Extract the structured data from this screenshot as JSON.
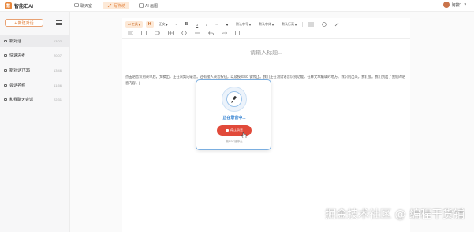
{
  "app": {
    "logo_text": "智能汇AI",
    "logo_badge": "慧"
  },
  "nav": {
    "tabs": [
      {
        "label": "聊天室",
        "active": false
      },
      {
        "label": "写作坊",
        "active": true
      },
      {
        "label": "AI 画图",
        "active": false
      }
    ]
  },
  "user": {
    "name": "阿搜1"
  },
  "sidebar": {
    "new_chat_label": "+ 新建对话",
    "conversations": [
      {
        "title": "新对话",
        "time": "13:02",
        "active": true
      },
      {
        "title": "快速思考",
        "time": "20:07",
        "active": false
      },
      {
        "title": "新对话7736",
        "time": "13:46",
        "active": false
      },
      {
        "title": "会话名称",
        "time": "11:56",
        "active": false
      },
      {
        "title": "和我聊天会话",
        "time": "22:31",
        "active": false
      }
    ]
  },
  "toolbar": {
    "ai_tools": "AI 工具",
    "h_label": "H",
    "body_label": "正文",
    "quote": "❝",
    "bold": "B",
    "underline": "U",
    "italic": "I",
    "more": "···",
    "strike": "S",
    "font_size": "默认字号",
    "font_family": "默认字体",
    "line_height": "默认行高"
  },
  "editor": {
    "title_placeholder": "请输入标题...",
    "body": "点击语音识别录单后，文稿出，正在采集的录音。还有接入录音按钮，以及按 ESC 键停止。我们正在测试语音识别功能，在聊文本编辑的地方。我识别出来，我们会。我们到出了我们的语音内容。|"
  },
  "recording": {
    "status": "正在录音中...",
    "stop_label": "停止录音",
    "hint": "按ESC键停止"
  },
  "watermark": "掘金技术社区 @ 编程干货铺",
  "colors": {
    "accent": "#e0782e",
    "record_blue": "#2f7fd0",
    "stop_red": "#e14a3a"
  }
}
